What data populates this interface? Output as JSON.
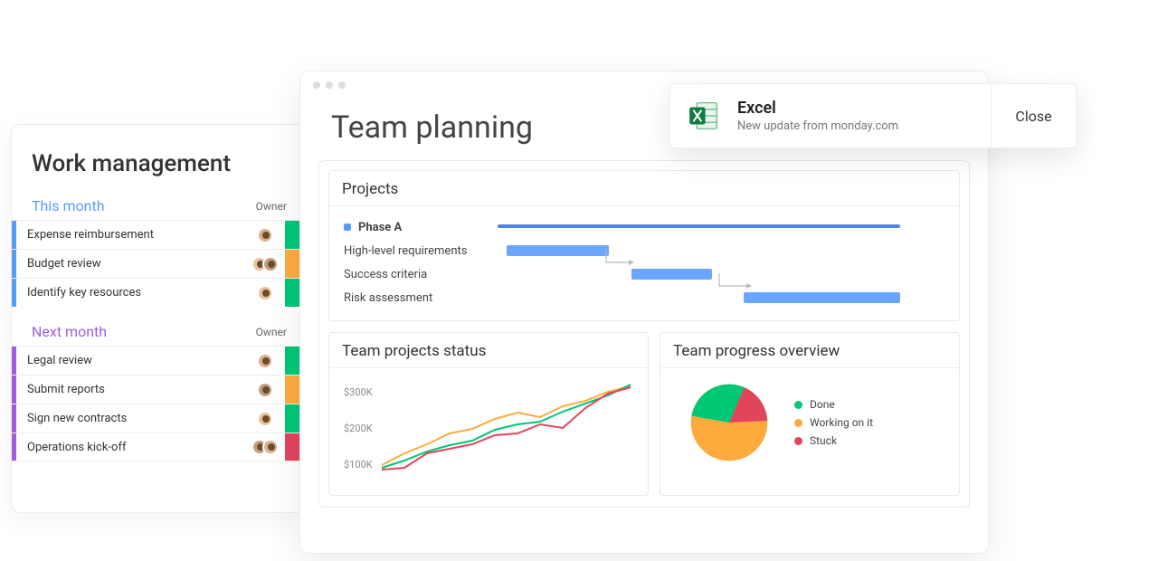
{
  "work_management": {
    "title": "Work management",
    "groups": [
      {
        "name": "This month",
        "color": "blue",
        "owner_header": "Owner",
        "rows": [
          {
            "label": "Expense reimbursement",
            "owners": 1,
            "status": "green"
          },
          {
            "label": "Budget review",
            "owners": 2,
            "status": "orange"
          },
          {
            "label": "Identify key resources",
            "owners": 1,
            "status": "green"
          }
        ]
      },
      {
        "name": "Next month",
        "color": "purple",
        "owner_header": "Owner",
        "rows": [
          {
            "label": "Legal review",
            "owners": 1,
            "status": "green"
          },
          {
            "label": "Submit reports",
            "owners": 1,
            "status": "orange"
          },
          {
            "label": "Sign new contracts",
            "owners": 1,
            "status": "green"
          },
          {
            "label": "Operations kick-off",
            "owners": 2,
            "status": "red"
          }
        ]
      }
    ]
  },
  "team_planning": {
    "title": "Team planning",
    "projects": {
      "title": "Projects",
      "phase_label": "Phase A",
      "tasks": [
        {
          "label": "High-level requirements"
        },
        {
          "label": "Success criteria"
        },
        {
          "label": "Risk assessment"
        }
      ]
    },
    "status_chart_title": "Team projects status",
    "progress_title": "Team progress overview",
    "progress_legend": {
      "done": "Done",
      "working": "Working on it",
      "stuck": "Stuck"
    }
  },
  "toast": {
    "app": "Excel",
    "message": "New update from monday.com",
    "close": "Close"
  },
  "chart_data": [
    {
      "type": "gantt",
      "title": "Projects",
      "rows": [
        {
          "label": "Phase A",
          "start": 0,
          "end": 90,
          "header": true
        },
        {
          "label": "High-level requirements",
          "start": 2,
          "end": 25
        },
        {
          "label": "Success criteria",
          "start": 30,
          "end": 48
        },
        {
          "label": "Risk assessment",
          "start": 55,
          "end": 90
        }
      ],
      "xrange": [
        0,
        100
      ]
    },
    {
      "type": "line",
      "title": "Team projects status",
      "ylabel": "",
      "yticks": [
        "$100K",
        "$200K",
        "$300K"
      ],
      "ylim": [
        80,
        320
      ],
      "x": [
        0,
        1,
        2,
        3,
        4,
        5,
        6,
        7,
        8,
        9,
        10,
        11
      ],
      "series": [
        {
          "name": "green",
          "values": [
            100,
            115,
            135,
            150,
            160,
            185,
            200,
            205,
            230,
            250,
            270,
            305
          ]
        },
        {
          "name": "orange",
          "values": [
            105,
            130,
            150,
            175,
            185,
            210,
            225,
            215,
            250,
            265,
            290,
            310
          ]
        },
        {
          "name": "red",
          "values": [
            95,
            100,
            130,
            140,
            150,
            170,
            175,
            200,
            190,
            240,
            275,
            300
          ]
        }
      ]
    },
    {
      "type": "pie",
      "title": "Team progress overview",
      "slices": [
        {
          "name": "Done",
          "value": 33,
          "color": "#00c875"
        },
        {
          "name": "Working on it",
          "value": 42,
          "color": "#fdab3d"
        },
        {
          "name": "Stuck",
          "value": 25,
          "color": "#e2445c"
        }
      ]
    }
  ]
}
